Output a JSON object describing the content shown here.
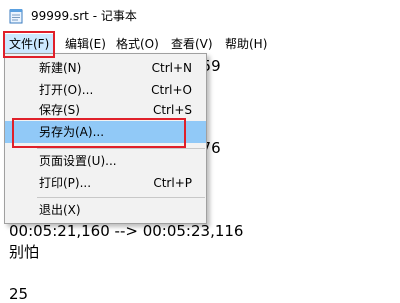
{
  "window": {
    "title": "99999.srt - 记事本",
    "icon": "notepad-icon"
  },
  "menubar": {
    "items": [
      {
        "label": "文件(F)"
      },
      {
        "label": "编辑(E)"
      },
      {
        "label": "格式(O)"
      },
      {
        "label": "查看(V)"
      },
      {
        "label": "帮助(H)"
      }
    ]
  },
  "file_menu": {
    "items": [
      {
        "label": "新建(N)",
        "shortcut": "Ctrl+N"
      },
      {
        "label": "打开(O)...",
        "shortcut": "Ctrl+O"
      },
      {
        "label": "保存(S)",
        "shortcut": "Ctrl+S"
      },
      {
        "label": "另存为(A)...",
        "shortcut": ""
      },
      {
        "label": "页面设置(U)...",
        "shortcut": ""
      },
      {
        "label": "打印(P)...",
        "shortcut": "Ctrl+P"
      },
      {
        "label": "退出(X)",
        "shortcut": ""
      }
    ]
  },
  "editor": {
    "visible_fragments": {
      "line1_tail": "559",
      "line2_tail": "576"
    },
    "lines": [
      "00:05:21,160 --> 00:05:23,116",
      "别怕",
      "",
      "25"
    ]
  },
  "colors": {
    "annotation_red": "#e0202a",
    "menu_hover": "#91c9f7",
    "menubar_active": "#cce8ff"
  }
}
